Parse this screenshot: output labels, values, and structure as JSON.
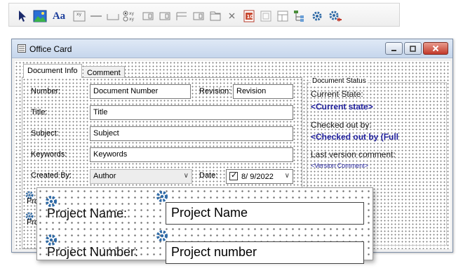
{
  "toolbar": {
    "text_tool_label": "Aa",
    "icons": [
      "pointer-icon",
      "image-icon",
      "text-icon",
      "xy-field-icon",
      "line-icon",
      "box-icon",
      "radio-xy-icon",
      "list-box-icon",
      "list-box-alt-icon",
      "lines-icon",
      "grid-box-icon",
      "tab-box-icon",
      "close-box-icon",
      "number-box-icon",
      "disabled-box-icon",
      "pages-icon",
      "tree-icon",
      "gear-icon",
      "gear-link-icon"
    ]
  },
  "window": {
    "title": "Office Card",
    "tabs": [
      {
        "label": "Document Info",
        "active": true
      },
      {
        "label": "Comment",
        "active": false
      }
    ],
    "form": {
      "number": {
        "label": "Number:",
        "value": "Document Number"
      },
      "revision": {
        "label": "Revision:",
        "value": "Revision"
      },
      "title": {
        "label": "Title:",
        "value": "Title"
      },
      "subject": {
        "label": "Subject:",
        "value": "Subject"
      },
      "keywords": {
        "label": "Keywords:",
        "value": "Keywords"
      },
      "created_by": {
        "label": "Created By:",
        "value": "Author"
      },
      "date": {
        "label": "Date:",
        "value": "8/ 9/2022"
      },
      "hidden_label_1": "Pro",
      "hidden_label_2": "Pro"
    },
    "status": {
      "legend": "Document Status",
      "current_state_label": "Current State:",
      "current_state_value": "<Current state>",
      "checked_out_label": "Checked out by:",
      "checked_out_value": "<Checked out by (Full",
      "last_comment_label": "Last version comment:",
      "last_comment_value": "<Version Comment>"
    }
  },
  "zoom": {
    "project_name_label": "Project Name:",
    "project_name_value": "Project Name",
    "project_number_label": "Project Number:",
    "project_number_value": "Project number"
  },
  "colors": {
    "accent_text": "#1f1f9e",
    "close_button": "#c2392a"
  }
}
